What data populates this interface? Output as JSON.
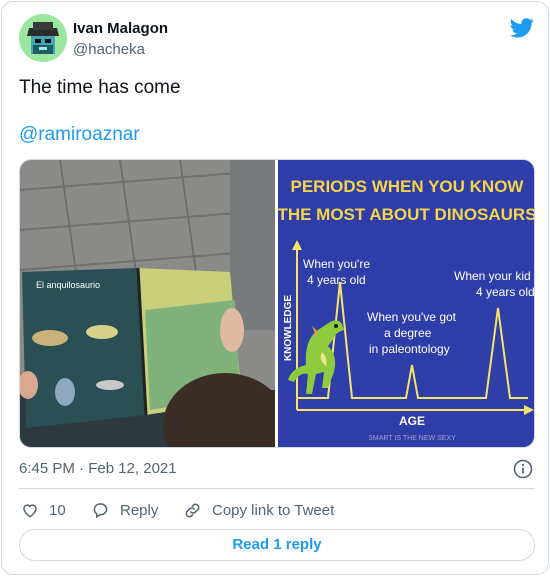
{
  "author": {
    "name": "Ivan Malagon",
    "handle": "@hacheka",
    "avatar_icon": "pixel-art-avatar"
  },
  "tweet": {
    "text": "The time has come",
    "mention": "@ramiroaznar"
  },
  "media": {
    "left_photo": {
      "description_icon": "dinosaur-book-photo",
      "book_title": "El anquilosaurio"
    },
    "right_meme": {
      "title_line1": "PERIODS WHEN YOU KNOW",
      "title_line2": "THE MOST ABOUT DINOSAURS",
      "y_axis_label": "KNOWLEDGE",
      "x_axis_label": "AGE",
      "peak1_line1": "When you're",
      "peak1_line2": "4 years old",
      "peak2_line1": "When you've got",
      "peak2_line2": "a degree",
      "peak2_line3": "in paleontology",
      "peak3_line1": "When your kid",
      "peak3_line2": "4 years old",
      "watermark": "SMART IS THE NEW SEXY",
      "colors": {
        "background": "#2e3da8",
        "text": "#ffffff",
        "title": "#f5d547",
        "line": "#f5e36b"
      }
    }
  },
  "meta": {
    "timestamp": "6:45 PM · Feb 12, 2021"
  },
  "actions": {
    "likes": "10",
    "reply_label": "Reply",
    "copy_link_label": "Copy link to Tweet",
    "read_replies_label": "Read 1 reply"
  },
  "colors": {
    "accent": "#1d9bf0",
    "muted": "#536471",
    "border": "#cfd9de"
  }
}
